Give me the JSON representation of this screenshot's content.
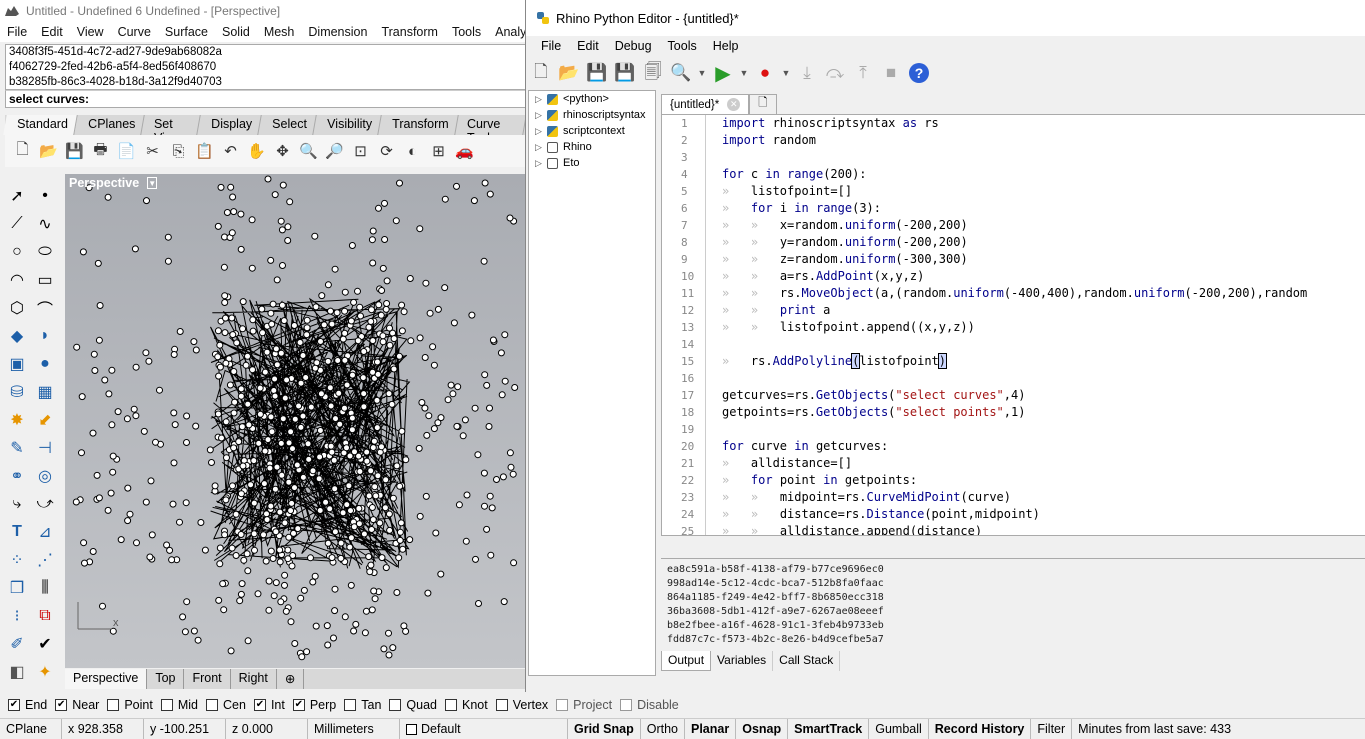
{
  "rhino": {
    "title": "Untitled - Undefined 6 Undefined - [Perspective]",
    "menu": [
      "File",
      "Edit",
      "View",
      "Curve",
      "Surface",
      "Solid",
      "Mesh",
      "Dimension",
      "Transform",
      "Tools",
      "Analyze"
    ],
    "command_history": [
      "3408f3f5-451d-4c72-ad27-9de9ab68082a",
      "f4062729-2fed-42b6-a5f4-8ed56f408670",
      "b38285fb-86c3-4028-b18d-3a12f9d40703"
    ],
    "command_prompt": "select curves:",
    "toolbar_tabs": [
      "Standard",
      "CPlanes",
      "Set View",
      "Display",
      "Select",
      "Visibility",
      "Transform",
      "Curve Tools"
    ],
    "viewport": {
      "name": "Perspective",
      "axis_label": "x"
    },
    "viewport_tabs": [
      "Perspective",
      "Top",
      "Front",
      "Right"
    ],
    "osnaps": [
      {
        "label": "End",
        "checked": true
      },
      {
        "label": "Near",
        "checked": true
      },
      {
        "label": "Point",
        "checked": false
      },
      {
        "label": "Mid",
        "checked": false
      },
      {
        "label": "Cen",
        "checked": false
      },
      {
        "label": "Int",
        "checked": true
      },
      {
        "label": "Perp",
        "checked": true
      },
      {
        "label": "Tan",
        "checked": false
      },
      {
        "label": "Quad",
        "checked": false
      },
      {
        "label": "Knot",
        "checked": false
      },
      {
        "label": "Vertex",
        "checked": false
      },
      {
        "label": "Project",
        "checked": false
      },
      {
        "label": "Disable",
        "checked": false
      }
    ],
    "status": {
      "cplane": "CPlane",
      "x": "x 928.358",
      "y": "y -100.251",
      "z": "z 0.000",
      "units": "Millimeters",
      "layer": "Default",
      "grid_snap": "Grid Snap",
      "ortho": "Ortho",
      "planar": "Planar",
      "osnap": "Osnap",
      "smarttrack": "SmartTrack",
      "gumball": "Gumball",
      "record_history": "Record History",
      "filter": "Filter",
      "save_info": "Minutes from last save: 433"
    }
  },
  "editor": {
    "title": "Rhino Python Editor - {untitled}*",
    "menu": [
      "File",
      "Edit",
      "Debug",
      "Tools",
      "Help"
    ],
    "tree": [
      "<python>",
      "rhinoscriptsyntax",
      "scriptcontext",
      "Rhino",
      "Eto"
    ],
    "tab": "{untitled}*",
    "output_lines": [
      "ea8c591a-b58f-4138-af79-b77ce9696ec0",
      "998ad14e-5c12-4cdc-bca7-512b8fa0faac",
      "864a1185-f249-4e42-bff7-8b6850ecc318",
      "36ba3608-5db1-412f-a9e7-6267ae08eeef",
      "b8e2fbee-a16f-4628-91c1-3feb4b9733eb",
      "fdd87c7c-f573-4b2c-8e26-b4d9cefbe5a7"
    ],
    "output_tabs": [
      "Output",
      "Variables",
      "Call Stack"
    ],
    "code": [
      "import rhinoscriptsyntax as rs",
      "import random",
      "",
      "for c in range(200):",
      "    listofpoint=[]",
      "    for i in range(3):",
      "        x=random.uniform(-200,200)",
      "        y=random.uniform(-200,200)",
      "        z=random.uniform(-300,300)",
      "        a=rs.AddPoint(x,y,z)",
      "        rs.MoveObject(a,(random.uniform(-400,400),random.uniform(-200,200),random",
      "        print a",
      "        listofpoint.append((x,y,z))",
      "",
      "    rs.AddPolyline(listofpoint)",
      "",
      "getcurves=rs.GetObjects(\"select curves\",4)",
      "getpoints=rs.GetObjects(\"select points\",1)",
      "",
      "for curve in getcurves:",
      "    alldistance=[]",
      "    for point in getpoints:",
      "        midpoint=rs.CurveMidPoint(curve)",
      "        distance=rs.Distance(point,midpoint)",
      "        alldistance.append(distance)"
    ]
  }
}
